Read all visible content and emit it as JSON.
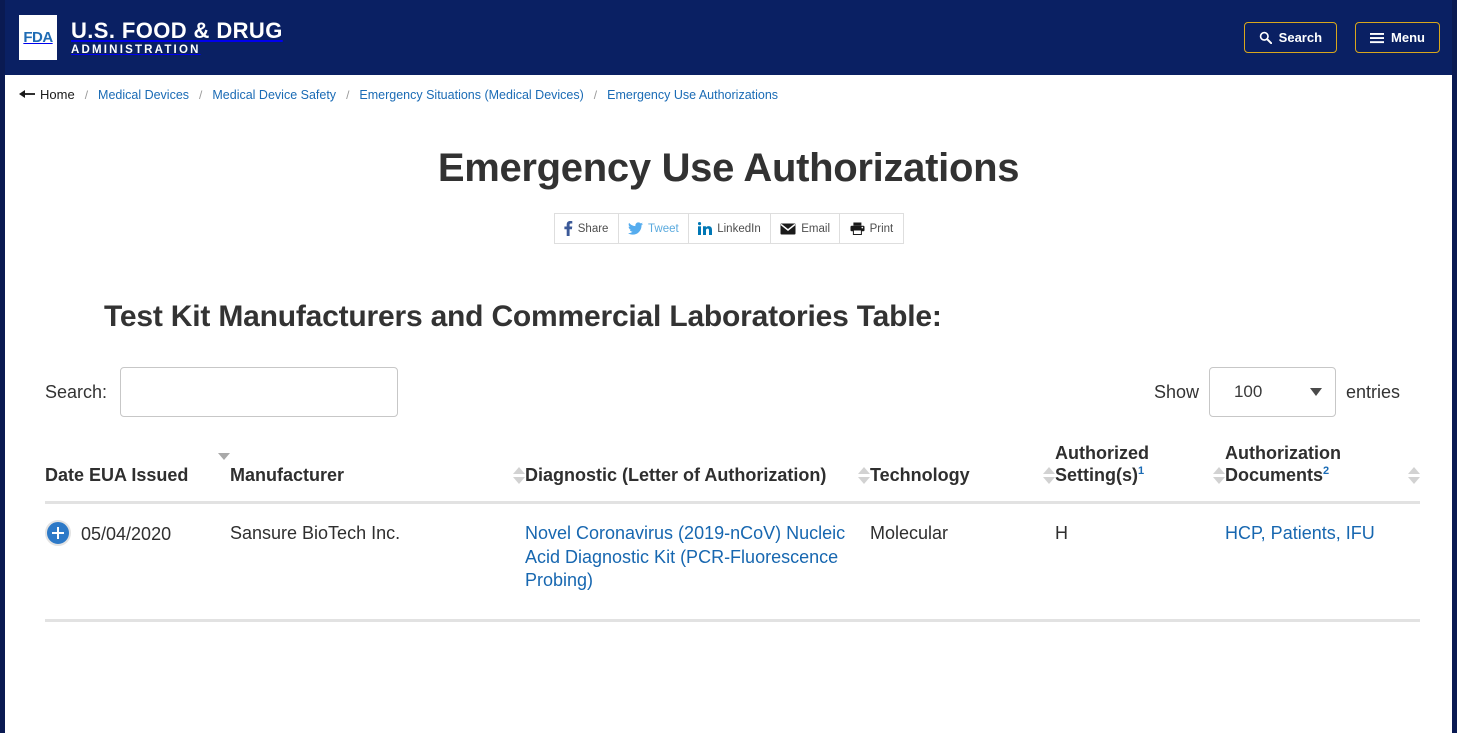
{
  "masthead": {
    "logo_text": "FDA",
    "brand_line1": "U.S. FOOD & DRUG",
    "brand_line2": "ADMINISTRATION",
    "search_button": "Search",
    "menu_button": "Menu",
    "accent_border": "#d9a71c",
    "background": "#0a2063"
  },
  "breadcrumb": {
    "home": "Home",
    "separator": "/",
    "items": [
      "Medical Devices",
      "Medical Device Safety",
      "Emergency Situations (Medical Devices)",
      "Emergency Use Authorizations"
    ]
  },
  "page": {
    "title": "Emergency Use Authorizations",
    "section_title": "Test Kit Manufacturers and Commercial Laboratories Table:"
  },
  "share_bar": [
    {
      "icon": "facebook-icon",
      "label": "Share",
      "style": "dark"
    },
    {
      "icon": "twitter-icon",
      "label": "Tweet",
      "style": "blue"
    },
    {
      "icon": "linkedin-icon",
      "label": "LinkedIn",
      "style": "dark"
    },
    {
      "icon": "email-icon",
      "label": "Email",
      "style": "dark"
    },
    {
      "icon": "print-icon",
      "label": "Print",
      "style": "dark"
    }
  ],
  "controls": {
    "search_label": "Search:",
    "search_value": "",
    "search_placeholder": "",
    "show_label": "Show",
    "entries_label": "entries",
    "page_length": "100"
  },
  "table": {
    "columns": [
      {
        "label": "Date EUA Issued",
        "sup": "",
        "sort": "desc"
      },
      {
        "label": "Manufacturer",
        "sup": "",
        "sort": "none"
      },
      {
        "label": "Diagnostic (Letter of Authorization)",
        "sup": "",
        "sort": "none"
      },
      {
        "label": "Technology",
        "sup": "",
        "sort": "none"
      },
      {
        "label": "Authorized Setting(s)",
        "sup": "1",
        "sort": "none"
      },
      {
        "label": "Authorization Documents",
        "sup": "2",
        "sort": "none"
      }
    ],
    "rows": [
      {
        "expander": "expand-row-icon",
        "date": "05/04/2020",
        "manufacturer": "Sansure BioTech Inc.",
        "diagnostic": "Novel Coronavirus (2019-nCoV) Nucleic Acid Diagnostic Kit (PCR-Fluorescence Probing)",
        "technology": "Molecular",
        "setting": "H",
        "documents": "HCP, Patients, IFU"
      }
    ]
  },
  "colors": {
    "link": "#1767b0",
    "header_blue": "#0a2063",
    "gold": "#d9a71c",
    "expander_blue": "#2d79c7"
  }
}
